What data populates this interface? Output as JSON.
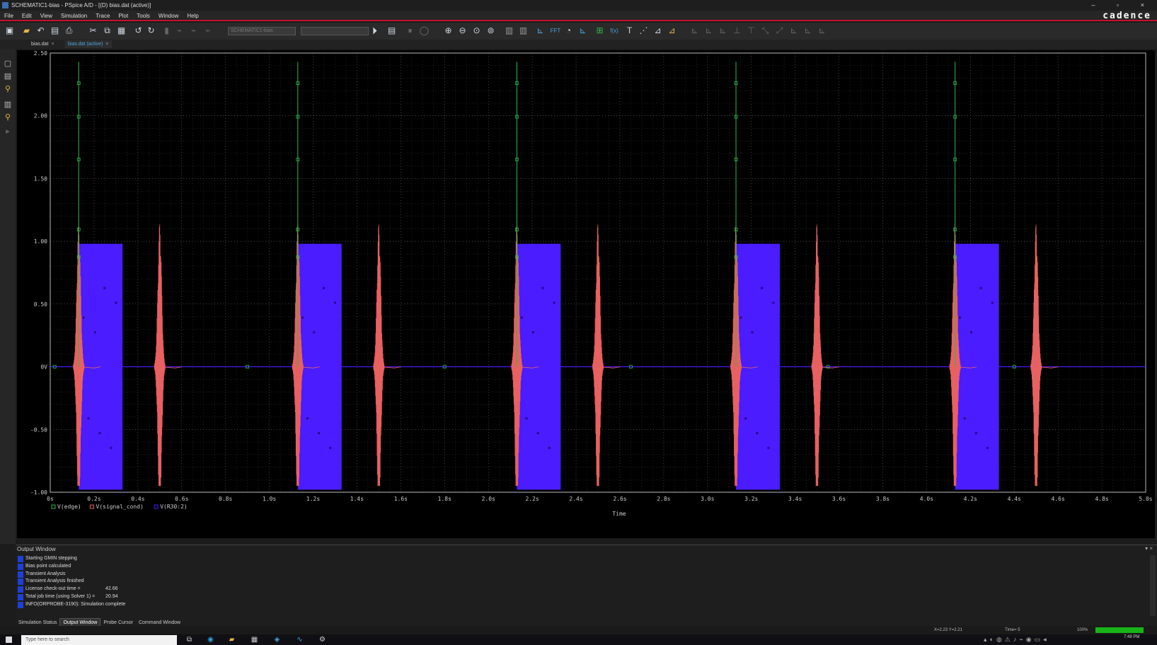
{
  "window": {
    "title": "SCHEMATIC1-bias - PSpice A/D - [(D) bias.dat (active)]",
    "controls": "– ▫ ×"
  },
  "menu": [
    "File",
    "Edit",
    "View",
    "Simulation",
    "Trace",
    "Plot",
    "Tools",
    "Window",
    "Help"
  ],
  "brand": "cadence",
  "toolbar": {
    "profile_field": "SCHEMATIC1-bias",
    "fft_label": "FFT",
    "fx_label": "f(x)"
  },
  "tabs": [
    {
      "label": "bias.dat",
      "active": false
    },
    {
      "label": "bias.dat (active)",
      "active": true
    }
  ],
  "chart_data": {
    "type": "line",
    "xlabel": "Time",
    "ylabel": "",
    "xlim": [
      0,
      5.0
    ],
    "ylim": [
      -1.0,
      2.5
    ],
    "x_ticks": [
      "0s",
      "0.2s",
      "0.4s",
      "0.6s",
      "0.8s",
      "1.0s",
      "1.2s",
      "1.4s",
      "1.6s",
      "1.8s",
      "2.0s",
      "2.2s",
      "2.4s",
      "2.6s",
      "2.8s",
      "3.0s",
      "3.2s",
      "3.4s",
      "3.6s",
      "3.8s",
      "4.0s",
      "4.2s",
      "4.4s",
      "4.6s",
      "4.8s",
      "5.0s"
    ],
    "y_ticks": [
      "2.50",
      "2.00",
      "1.50",
      "1.00",
      "0.50",
      "0V",
      "-0.50",
      "-1.00"
    ],
    "grid": true,
    "legend_placement": "bottom-left",
    "series": [
      {
        "name": "V(edge)",
        "color": "#2fb84a",
        "marker": "square",
        "description_points": {
          "spike_times": [
            0.13,
            1.13,
            2.13,
            3.13,
            4.13
          ],
          "spike_peaks": [
            2.43,
            2.43,
            2.43,
            2.43,
            2.43
          ],
          "baseline": 0
        }
      },
      {
        "name": "V(signal_cond)",
        "color": "#e86060",
        "marker": "x",
        "burst_times": [
          0.13,
          0.5,
          1.13,
          1.5,
          2.13,
          2.5,
          3.13,
          3.5,
          4.13,
          4.5
        ],
        "burst_peak": 1.15,
        "burst_trough": -0.95,
        "baseline": 0
      },
      {
        "name": "V(R30:2)",
        "color": "#4a1cff",
        "marker": "dot",
        "block_starts": [
          0.13,
          1.13,
          2.13,
          3.13,
          4.13
        ],
        "block_ends": [
          0.33,
          1.33,
          2.33,
          3.33,
          4.33
        ],
        "block_high": 0.98,
        "block_low": -0.98,
        "baseline": 0
      }
    ]
  },
  "output": {
    "header": "Output Window",
    "header_controls": "▾ ×",
    "lines": [
      {
        "text": "Starting GMIN stepping",
        "value": ""
      },
      {
        "text": "Bias point calculated",
        "value": ""
      },
      {
        "text": "Transient Analysis",
        "value": ""
      },
      {
        "text": "Transient Analysis finished",
        "value": ""
      },
      {
        "text": "License check-out time        =",
        "value": "42.66"
      },
      {
        "text": "Total job time (using Solver 1)  =",
        "value": "20.94"
      },
      {
        "text": "INFO(ORPROBE-3190): Simulation complete",
        "value": ""
      }
    ],
    "tabs": [
      {
        "label": "Simulation Status",
        "active": false
      },
      {
        "label": "Output Window",
        "active": true
      },
      {
        "label": "Probe Cursor",
        "active": false
      },
      {
        "label": "Command Window",
        "active": false
      }
    ]
  },
  "status": {
    "coords": "X=2.23  Y=2.21",
    "time": "Time= 5",
    "percent": "100%",
    "progress": 1.0
  },
  "taskbar": {
    "search_placeholder": "Type here to search",
    "clock_time": "7:48 PM",
    "clock_date": ""
  }
}
